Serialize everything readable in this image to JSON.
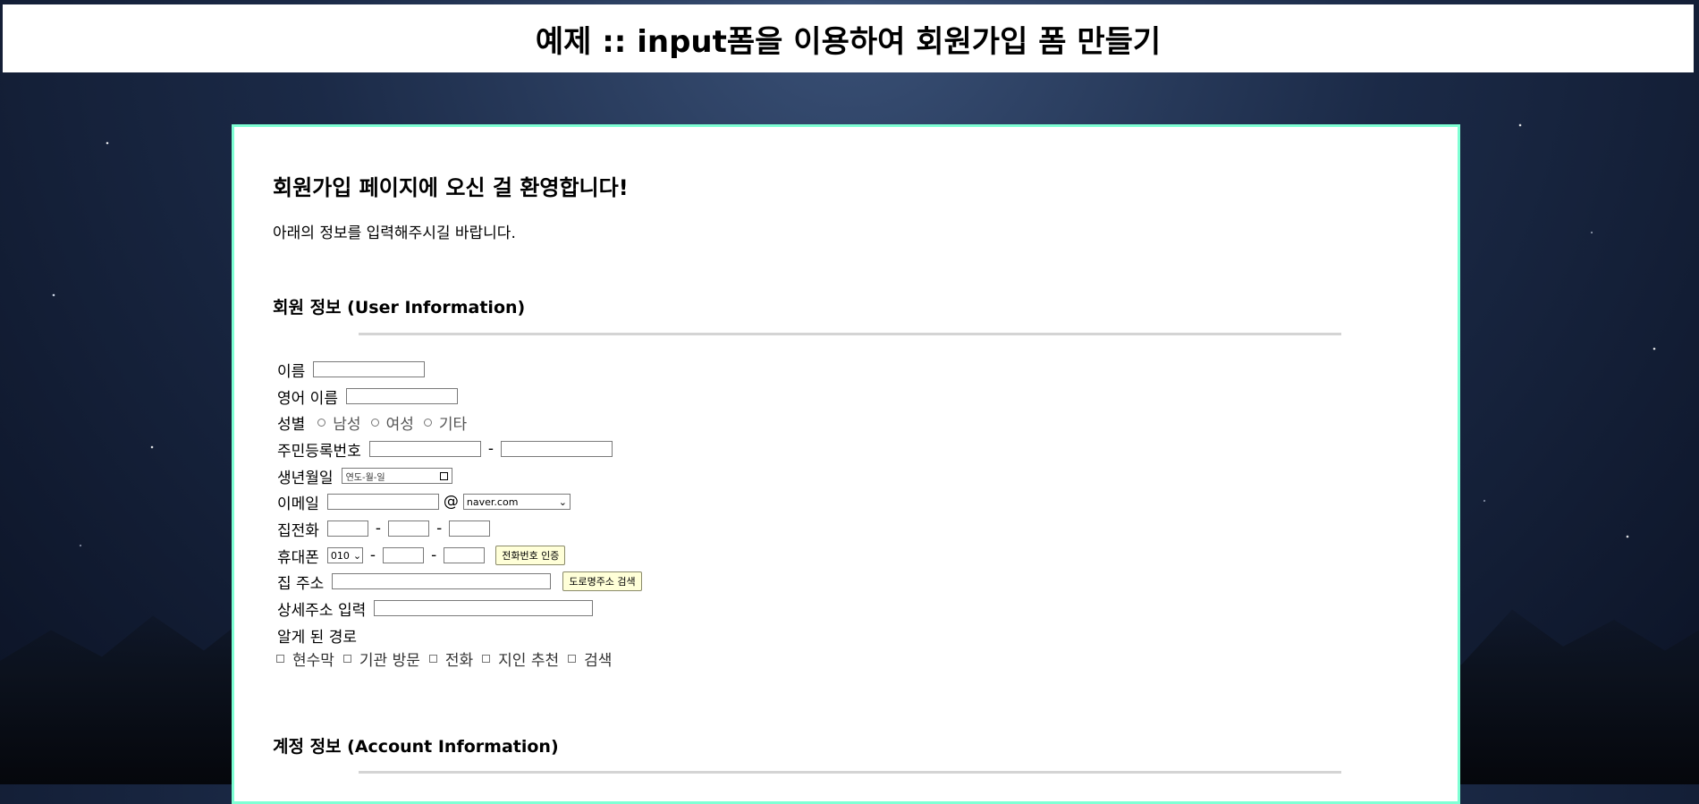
{
  "header": {
    "title": "예제 :: input폼을 이용하여 회원가입 폼 만들기"
  },
  "card": {
    "welcome": "회원가입 페이지에 오신 걸 환영합니다!",
    "subtitle": "아래의 정보를 입력해주시길 바랍니다."
  },
  "user_section": {
    "title": "회원 정보 (User Information)",
    "name_label": "이름",
    "english_name_label": "영어 이름",
    "gender_label": "성별",
    "gender_options": [
      "남성",
      "여성",
      "기타"
    ],
    "rrn_label": "주민등록번호",
    "dash": "-",
    "birth_label": "생년월일",
    "birth_placeholder": "연도-월-일",
    "email_label": "이메일",
    "email_at": "@",
    "email_domain": "naver.com",
    "home_phone_label": "집전화",
    "mobile_label": "휴대폰",
    "mobile_prefix": "010",
    "phone_verify_button": "전화번호 인증",
    "address_label": "집 주소",
    "address_search_button": "도로명주소 검색",
    "address_detail_label": "상세주소 입력",
    "referral_label": "알게 된 경로",
    "referral_options": [
      "현수막",
      "기관 방문",
      "전화",
      "지인 추천",
      "검색"
    ]
  },
  "account_section": {
    "title": "계정 정보 (Account Information)"
  }
}
